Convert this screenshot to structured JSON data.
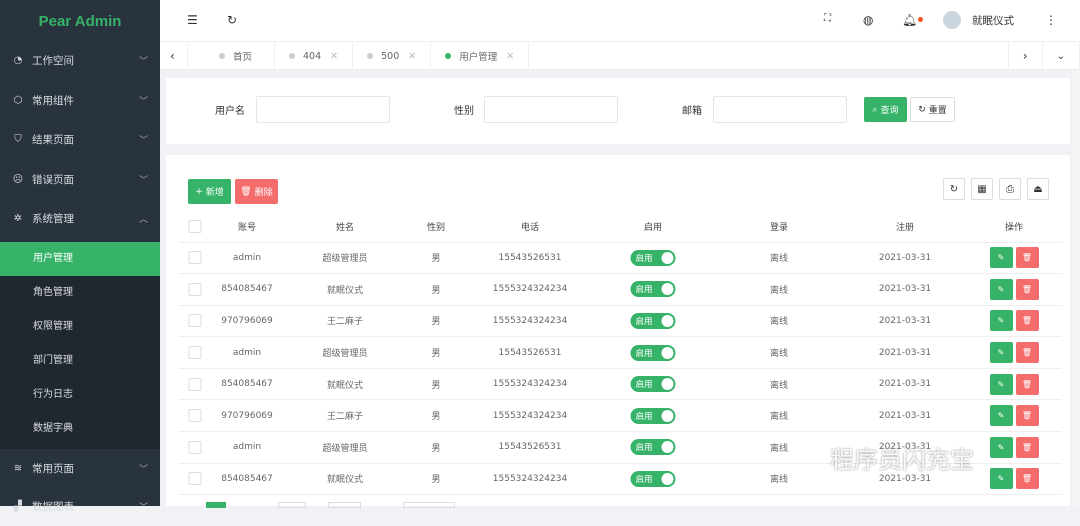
{
  "app": {
    "title": "Pear Admin"
  },
  "sidebar": {
    "items": [
      {
        "label": "工作空间",
        "icon": "dashboard-icon"
      },
      {
        "label": "常用组件",
        "icon": "cube-icon"
      },
      {
        "label": "结果页面",
        "icon": "shield-icon"
      },
      {
        "label": "错误页面",
        "icon": "face-icon"
      },
      {
        "label": "系统管理",
        "icon": "gear-icon"
      }
    ],
    "subitems": [
      "用户管理",
      "角色管理",
      "权限管理",
      "部门管理",
      "行为日志",
      "数据字典"
    ],
    "more": [
      {
        "label": "常用页面",
        "icon": "layers-icon"
      },
      {
        "label": "数据图表",
        "icon": "chart-icon"
      }
    ]
  },
  "header": {
    "user": "就眠仪式"
  },
  "tabs": [
    {
      "label": "首页"
    },
    {
      "label": "404"
    },
    {
      "label": "500"
    },
    {
      "label": "用户管理"
    }
  ],
  "search": {
    "username_label": "用户名",
    "gender_label": "性别",
    "email_label": "邮箱",
    "query": "查询",
    "reset": "重置"
  },
  "toolbar": {
    "add": "新增",
    "delete": "删除"
  },
  "table": {
    "columns": [
      "账号",
      "姓名",
      "性别",
      "电话",
      "启用",
      "登录",
      "注册",
      "操作"
    ],
    "switch_label": "启用",
    "rows": [
      [
        "admin",
        "超级管理员",
        "男",
        "15543526531",
        "离线",
        "2021-03-31"
      ],
      [
        "854085467",
        "就眠仪式",
        "男",
        "1555324324234",
        "离线",
        "2021-03-31"
      ],
      [
        "970796069",
        "王二麻子",
        "男",
        "1555324324234",
        "离线",
        "2021-03-31"
      ],
      [
        "admin",
        "超级管理员",
        "男",
        "15543526531",
        "离线",
        "2021-03-31"
      ],
      [
        "854085467",
        "就眠仪式",
        "男",
        "1555324324234",
        "离线",
        "2021-03-31"
      ],
      [
        "970796069",
        "王二麻子",
        "男",
        "1555324324234",
        "离线",
        "2021-03-31"
      ],
      [
        "admin",
        "超级管理员",
        "男",
        "15543526531",
        "离线",
        "2021-03-31"
      ],
      [
        "854085467",
        "就眠仪式",
        "男",
        "1555324324234",
        "离线",
        "2021-03-31"
      ]
    ]
  },
  "watermark": "程序员闪充宝",
  "colors": {
    "primary": "#36b368",
    "danger": "#f56c6c",
    "sidebar": "#28333e"
  }
}
